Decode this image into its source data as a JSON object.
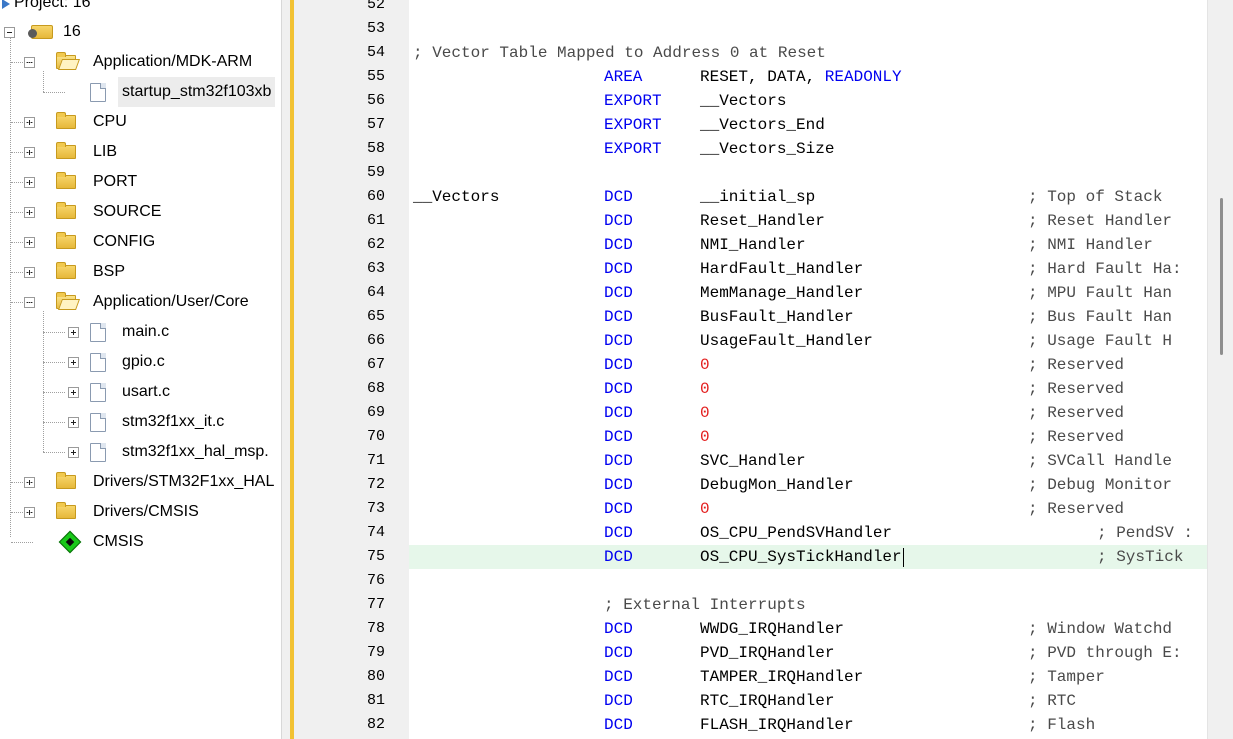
{
  "project_tree": {
    "header": "Project: 16",
    "root": "16",
    "items": [
      {
        "label": "Application/MDK-ARM",
        "kind": "folder",
        "expanded": true,
        "depth": 1
      },
      {
        "label": "startup_stm32f103xb",
        "kind": "file",
        "selected": true,
        "depth": 2
      },
      {
        "label": "CPU",
        "kind": "folder",
        "expanded": false,
        "depth": 1
      },
      {
        "label": "LIB",
        "kind": "folder",
        "expanded": false,
        "depth": 1
      },
      {
        "label": "PORT",
        "kind": "folder",
        "expanded": false,
        "depth": 1
      },
      {
        "label": "SOURCE",
        "kind": "folder",
        "expanded": false,
        "depth": 1
      },
      {
        "label": "CONFIG",
        "kind": "folder",
        "expanded": false,
        "depth": 1
      },
      {
        "label": "BSP",
        "kind": "folder",
        "expanded": false,
        "depth": 1
      },
      {
        "label": "Application/User/Core",
        "kind": "folder",
        "expanded": true,
        "depth": 1
      },
      {
        "label": "main.c",
        "kind": "file",
        "depth": 2
      },
      {
        "label": "gpio.c",
        "kind": "file",
        "depth": 2
      },
      {
        "label": "usart.c",
        "kind": "file",
        "depth": 2
      },
      {
        "label": "stm32f1xx_it.c",
        "kind": "file",
        "depth": 2
      },
      {
        "label": "stm32f1xx_hal_msp.",
        "kind": "file",
        "depth": 2
      },
      {
        "label": "Drivers/STM32F1xx_HAL",
        "kind": "folder",
        "expanded": false,
        "depth": 1
      },
      {
        "label": "Drivers/CMSIS",
        "kind": "folder",
        "expanded": false,
        "depth": 1
      },
      {
        "label": "CMSIS",
        "kind": "component",
        "depth": 1
      }
    ]
  },
  "editor": {
    "current_line": "75",
    "lines": [
      {
        "n": "52"
      },
      {
        "n": "53"
      },
      {
        "n": "54",
        "code": "; Vector Table Mapped to Address 0 at Reset"
      },
      {
        "n": "55",
        "op": "AREA",
        "arg": "RESET, DATA, ",
        "arg_kw": "READONLY"
      },
      {
        "n": "56",
        "op": "EXPORT",
        "arg": "__Vectors"
      },
      {
        "n": "57",
        "op": "EXPORT",
        "arg": "__Vectors_End"
      },
      {
        "n": "58",
        "op": "EXPORT",
        "arg": "__Vectors_Size"
      },
      {
        "n": "59"
      },
      {
        "n": "60",
        "label": "__Vectors",
        "op": "DCD",
        "arg": "__initial_sp",
        "comment": "; Top of Stack"
      },
      {
        "n": "61",
        "op": "DCD",
        "arg": "Reset_Handler",
        "comment": "; Reset Handler"
      },
      {
        "n": "62",
        "op": "DCD",
        "arg": "NMI_Handler",
        "comment": "; NMI Handler"
      },
      {
        "n": "63",
        "op": "DCD",
        "arg": "HardFault_Handler",
        "comment": "; Hard Fault Ha:"
      },
      {
        "n": "64",
        "op": "DCD",
        "arg": "MemManage_Handler",
        "comment": "; MPU Fault Han"
      },
      {
        "n": "65",
        "op": "DCD",
        "arg": "BusFault_Handler",
        "comment": "; Bus Fault Han"
      },
      {
        "n": "66",
        "op": "DCD",
        "arg": "UsageFault_Handler",
        "comment": "; Usage Fault H"
      },
      {
        "n": "67",
        "op": "DCD",
        "arg_num": "0",
        "comment": "; Reserved"
      },
      {
        "n": "68",
        "op": "DCD",
        "arg_num": "0",
        "comment": "; Reserved"
      },
      {
        "n": "69",
        "op": "DCD",
        "arg_num": "0",
        "comment": "; Reserved"
      },
      {
        "n": "70",
        "op": "DCD",
        "arg_num": "0",
        "comment": "; Reserved"
      },
      {
        "n": "71",
        "op": "DCD",
        "arg": "SVC_Handler",
        "comment": "; SVCall Handle"
      },
      {
        "n": "72",
        "op": "DCD",
        "arg": "DebugMon_Handler",
        "comment": "; Debug Monitor"
      },
      {
        "n": "73",
        "op": "DCD",
        "arg_num": "0",
        "comment": "; Reserved"
      },
      {
        "n": "74",
        "op": "DCD",
        "arg": "OS_CPU_PendSVHandler",
        "comment2": "; PendSV :"
      },
      {
        "n": "75",
        "op": "DCD",
        "arg": "OS_CPU_SysTickHandler",
        "comment2": "; SysTick"
      },
      {
        "n": "76"
      },
      {
        "n": "77",
        "code_op": "; External Interrupts"
      },
      {
        "n": "78",
        "op": "DCD",
        "arg": "WWDG_IRQHandler",
        "comment": "; Window Watchd"
      },
      {
        "n": "79",
        "op": "DCD",
        "arg": "PVD_IRQHandler",
        "comment": "; PVD through E:"
      },
      {
        "n": "80",
        "op": "DCD",
        "arg": "TAMPER_IRQHandler",
        "comment": "; Tamper"
      },
      {
        "n": "81",
        "op": "DCD",
        "arg": "RTC_IRQHandler",
        "comment": "; RTC"
      },
      {
        "n": "82",
        "op": "DCD",
        "arg": "FLASH_IRQHandler",
        "comment": "; Flash"
      }
    ]
  },
  "colors": {
    "keyword": "#0000f0",
    "number": "#e31c1c",
    "current_line_bg": "#e6f7ea",
    "splitter_accent": "#f2c233"
  }
}
